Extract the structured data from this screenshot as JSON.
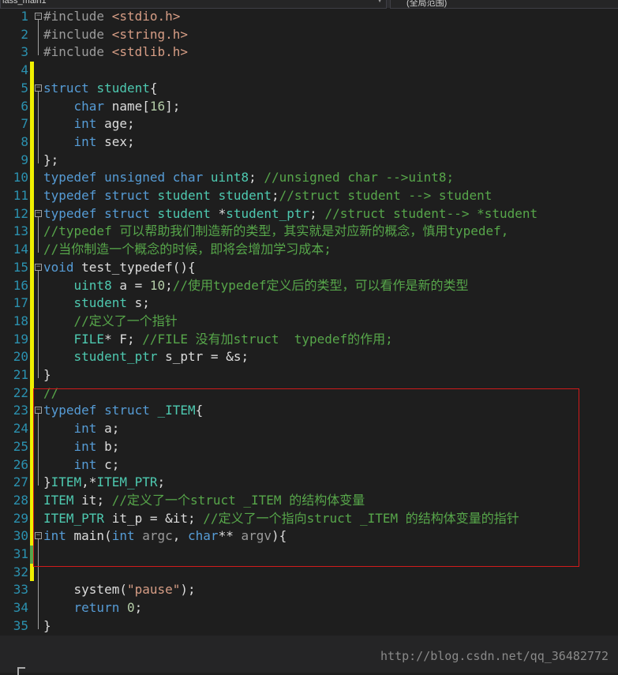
{
  "toolbar": {
    "left_dropdown": "lass_main1",
    "right_dropdown": "(全局范围)"
  },
  "lines": [
    {
      "n": "1",
      "segs": [
        [
          "p",
          "#include "
        ],
        [
          "s",
          "<stdio.h>"
        ]
      ]
    },
    {
      "n": "2",
      "segs": [
        [
          "p",
          "#include "
        ],
        [
          "s",
          "<string.h>"
        ]
      ]
    },
    {
      "n": "3",
      "segs": [
        [
          "p",
          "#include "
        ],
        [
          "s",
          "<stdlib.h>"
        ]
      ]
    },
    {
      "n": "4",
      "segs": []
    },
    {
      "n": "5",
      "segs": [
        [
          "k",
          "struct "
        ],
        [
          "t",
          "student"
        ],
        [
          "d",
          "{"
        ]
      ]
    },
    {
      "n": "6",
      "segs": [
        [
          "d",
          "    "
        ],
        [
          "k",
          "char "
        ],
        [
          "d",
          "name["
        ],
        [
          "n",
          "16"
        ],
        [
          "d",
          "];"
        ]
      ]
    },
    {
      "n": "7",
      "segs": [
        [
          "d",
          "    "
        ],
        [
          "k",
          "int "
        ],
        [
          "d",
          "age;"
        ]
      ]
    },
    {
      "n": "8",
      "segs": [
        [
          "d",
          "    "
        ],
        [
          "k",
          "int "
        ],
        [
          "d",
          "sex;"
        ]
      ]
    },
    {
      "n": "9",
      "segs": [
        [
          "d",
          "};"
        ]
      ]
    },
    {
      "n": "10",
      "segs": [
        [
          "k",
          "typedef unsigned char "
        ],
        [
          "t",
          "uint8"
        ],
        [
          "d",
          "; "
        ],
        [
          "c",
          "//unsigned char -->uint8;"
        ]
      ]
    },
    {
      "n": "11",
      "segs": [
        [
          "k",
          "typedef struct "
        ],
        [
          "t",
          "student student"
        ],
        [
          "d",
          ";"
        ],
        [
          "c",
          "//struct student --> student"
        ]
      ]
    },
    {
      "n": "12",
      "segs": [
        [
          "k",
          "typedef struct "
        ],
        [
          "t",
          "student "
        ],
        [
          "d",
          "*"
        ],
        [
          "t",
          "student_ptr"
        ],
        [
          "d",
          "; "
        ],
        [
          "c",
          "//struct student--> *student"
        ]
      ]
    },
    {
      "n": "13",
      "segs": [
        [
          "c",
          "//typedef 可以帮助我们制造新的类型，其实就是对应新的概念，慎用typedef,"
        ]
      ]
    },
    {
      "n": "14",
      "segs": [
        [
          "c",
          "//当你制造一个概念的时候，即将会增加学习成本;"
        ]
      ]
    },
    {
      "n": "15",
      "segs": [
        [
          "k",
          "void "
        ],
        [
          "d",
          "test_typedef(){"
        ]
      ]
    },
    {
      "n": "16",
      "segs": [
        [
          "d",
          "    "
        ],
        [
          "t",
          "uint8 "
        ],
        [
          "d",
          "a = "
        ],
        [
          "n",
          "10"
        ],
        [
          "d",
          ";"
        ],
        [
          "c",
          "//使用typedef定义后的类型，可以看作是新的类型"
        ]
      ]
    },
    {
      "n": "17",
      "segs": [
        [
          "d",
          "    "
        ],
        [
          "t",
          "student "
        ],
        [
          "d",
          "s;"
        ]
      ]
    },
    {
      "n": "18",
      "segs": [
        [
          "d",
          "    "
        ],
        [
          "c",
          "//定义了一个指针"
        ]
      ]
    },
    {
      "n": "19",
      "segs": [
        [
          "d",
          "    "
        ],
        [
          "t",
          "FILE"
        ],
        [
          "d",
          "* F; "
        ],
        [
          "c",
          "//FILE 没有加struct  typedef的作用;"
        ]
      ]
    },
    {
      "n": "20",
      "segs": [
        [
          "d",
          "    "
        ],
        [
          "t",
          "student_ptr "
        ],
        [
          "d",
          "s_ptr = &s;"
        ]
      ]
    },
    {
      "n": "21",
      "segs": [
        [
          "d",
          "}"
        ]
      ]
    },
    {
      "n": "22",
      "segs": [
        [
          "c",
          "//"
        ]
      ]
    },
    {
      "n": "23",
      "segs": [
        [
          "k",
          "typedef struct "
        ],
        [
          "t",
          "_ITEM"
        ],
        [
          "d",
          "{"
        ]
      ]
    },
    {
      "n": "24",
      "segs": [
        [
          "d",
          "    "
        ],
        [
          "k",
          "int "
        ],
        [
          "d",
          "a;"
        ]
      ]
    },
    {
      "n": "25",
      "segs": [
        [
          "d",
          "    "
        ],
        [
          "k",
          "int "
        ],
        [
          "d",
          "b;"
        ]
      ]
    },
    {
      "n": "26",
      "segs": [
        [
          "d",
          "    "
        ],
        [
          "k",
          "int "
        ],
        [
          "d",
          "c;"
        ]
      ]
    },
    {
      "n": "27",
      "segs": [
        [
          "d",
          "}"
        ],
        [
          "t",
          "ITEM"
        ],
        [
          "d",
          ",*"
        ],
        [
          "t",
          "ITEM_PTR"
        ],
        [
          "d",
          ";"
        ]
      ]
    },
    {
      "n": "28",
      "segs": [
        [
          "t",
          "ITEM "
        ],
        [
          "d",
          "it; "
        ],
        [
          "c",
          "//定义了一个struct _ITEM 的结构体变量"
        ]
      ]
    },
    {
      "n": "29",
      "segs": [
        [
          "t",
          "ITEM_PTR "
        ],
        [
          "d",
          "it_p = &it; "
        ],
        [
          "c",
          "//定义了一个指向struct _ITEM 的结构体变量的指针"
        ]
      ]
    },
    {
      "n": "30",
      "segs": [
        [
          "k",
          "int "
        ],
        [
          "d",
          "main("
        ],
        [
          "k",
          "int "
        ],
        [
          "p",
          "argc"
        ],
        [
          "d",
          ", "
        ],
        [
          "k",
          "char"
        ],
        [
          "d",
          "** "
        ],
        [
          "p",
          "argv"
        ],
        [
          "d",
          "){"
        ]
      ]
    },
    {
      "n": "31",
      "segs": []
    },
    {
      "n": "32",
      "segs": []
    },
    {
      "n": "33",
      "segs": [
        [
          "d",
          "    system("
        ],
        [
          "s",
          "\"pause\""
        ],
        [
          "d",
          ");"
        ]
      ]
    },
    {
      "n": "34",
      "segs": [
        [
          "d",
          "    "
        ],
        [
          "k",
          "return "
        ],
        [
          "n",
          "0"
        ],
        [
          "d",
          ";"
        ]
      ]
    },
    {
      "n": "35",
      "segs": [
        [
          "d",
          "}"
        ]
      ]
    }
  ],
  "folds": [
    "1",
    "5",
    "12",
    "15",
    "23",
    "30"
  ],
  "watermark": "http://blog.csdn.net/qq_36482772",
  "colors": {
    "background": "#1e1e1e",
    "keyword": "#569cd6",
    "type": "#4ec9b0",
    "comment": "#57a64a",
    "string": "#d69d85",
    "number": "#b5cea8",
    "preprocessor": "#9b9b9b",
    "line_number": "#2b91af",
    "change_bar": "#efef00",
    "saved_bar": "#57a64a",
    "highlight_box": "#d01b1b"
  }
}
